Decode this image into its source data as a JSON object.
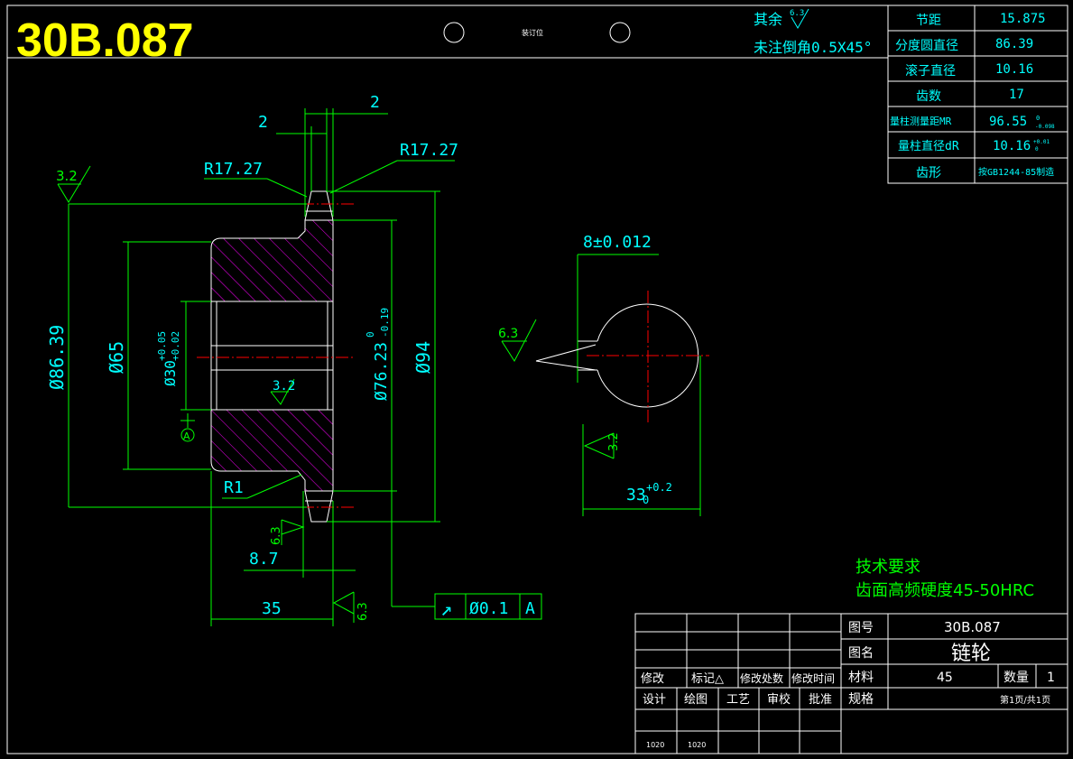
{
  "drawing_number_title": "30B.087",
  "binding_label": "装订位",
  "notes_top": {
    "rest_roughness_label": "其余",
    "rest_roughness_value": "6.3",
    "chamfer_note": "未注倒角0.5X45°"
  },
  "params_table": [
    {
      "label": "节距",
      "value": "15.875"
    },
    {
      "label": "分度圆直径",
      "value": "86.39"
    },
    {
      "label": "滚子直径",
      "value": "10.16"
    },
    {
      "label": "齿数",
      "value": "17"
    },
    {
      "label": "量柱测量距MR",
      "value": "96.55",
      "tol_up": "0",
      "tol_dn": "-0.098"
    },
    {
      "label": "量柱直径dR",
      "value": "10.16",
      "tol_up": "+0.01",
      "tol_dn": "0"
    },
    {
      "label": "齿形",
      "value": "按GB1244-85制造"
    }
  ],
  "dimensions": {
    "d_tip_width_left": "2",
    "d_tip_width_right": "2",
    "r_left": "R17.27",
    "r_right": "R17.27",
    "rough_top_left": "3.2",
    "dia_pitch": "Ø86.39",
    "dia_hub": "Ø65",
    "dia_bore": "Ø30",
    "dia_bore_tol_up": "+0.05",
    "dia_bore_tol_dn": "+0.02",
    "rough_bore": "3.2",
    "dia_root": "Ø76.23",
    "dia_root_tol_up": "0",
    "dia_root_tol_dn": "-0.19",
    "dia_outer": "Ø94",
    "datum": "A",
    "fillet": "R1",
    "rough_tooth": "6.3",
    "width_tooth": "8.7",
    "width_total": "35",
    "rough_face": "6.3",
    "runout_symbol": "↗",
    "runout_value": "Ø0.1",
    "runout_datum": "A",
    "key_width": "8±0.012",
    "rough_key": "6.3",
    "rough_key_side": "3.2",
    "key_depth": "33",
    "key_depth_tol_up": "+0.2",
    "key_depth_tol_dn": "0"
  },
  "tech_req": {
    "title": "技术要求",
    "line1": "齿面高频硬度45-50HRC"
  },
  "title_block": {
    "drawing_no_label": "图号",
    "drawing_no": "30B.087",
    "name_label": "图名",
    "name": "链轮",
    "material_label": "材料",
    "material": "45",
    "qty_label": "数量",
    "qty": "1",
    "spec_label": "规格",
    "sheet": "第1页/共1页",
    "revise_labels": [
      "修改",
      "标记△",
      "修改处数",
      "修改时间"
    ],
    "sign_labels": [
      "设计",
      "绘图",
      "工艺",
      "审校",
      "批准"
    ],
    "dates": [
      "1020",
      "1020"
    ]
  }
}
